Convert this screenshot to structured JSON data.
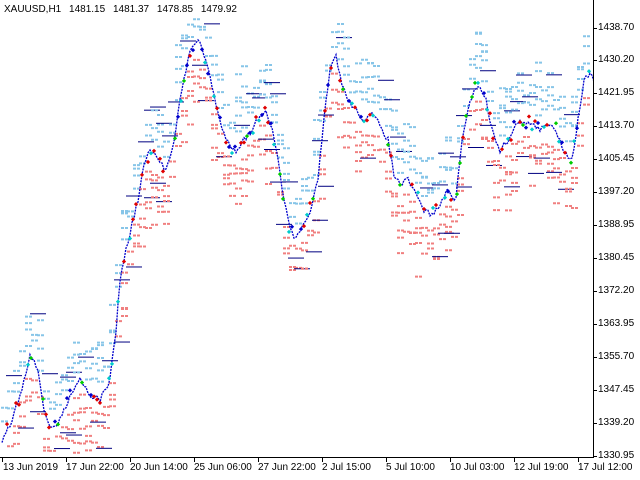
{
  "header": {
    "symbol": "XAUUSD,H1",
    "open": "1481.15",
    "high": "1481.37",
    "low": "1478.85",
    "close": "1479.92"
  },
  "price_axis": {
    "labels": [
      "1438.70",
      "1430.20",
      "1421.95",
      "1413.70",
      "1405.45",
      "1397.20",
      "1388.95",
      "1380.45",
      "1372.20",
      "1363.95",
      "1355.70",
      "1347.45",
      "1339.20",
      "1330.95"
    ]
  },
  "time_axis": {
    "labels": [
      "13 Jun 2019",
      "17 Jun 22:00",
      "20 Jun 14:00",
      "25 Jun 06:00",
      "27 Jun 22:00",
      "2 Jul 15:00",
      "5 Jul 10:00",
      "10 Jul 03:00",
      "12 Jul 19:00",
      "17 Jul 12:00"
    ]
  },
  "colors": {
    "background": "#ffffff",
    "axis": "#000000",
    "line_blue": "#0000cc",
    "line_navy": "#000080",
    "marker_lightblue": "#87c5e8",
    "marker_salmon": "#f08080",
    "marker_red": "#e00000",
    "marker_green": "#00cc00",
    "marker_cyan": "#00cccc"
  },
  "icons": {
    "marker": "arrow-diamond-icon"
  }
}
